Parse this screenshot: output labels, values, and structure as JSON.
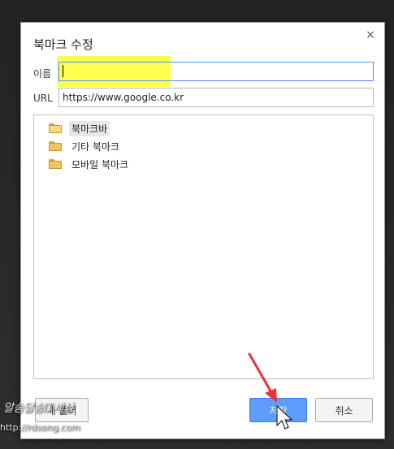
{
  "dialog": {
    "title": "북마크 수정",
    "close_glyph": "×"
  },
  "form": {
    "name_label": "이름",
    "name_value": "",
    "url_label": "URL",
    "url_value": "https://www.google.co.kr"
  },
  "tree": {
    "items": [
      {
        "label": "북마크바",
        "icon": "folder-open-icon",
        "selected": true
      },
      {
        "label": "기타 북마크",
        "icon": "folder-icon",
        "selected": false
      },
      {
        "label": "모바일 북마크",
        "icon": "folder-icon",
        "selected": false
      }
    ]
  },
  "buttons": {
    "new_folder_label": "새 폴더",
    "save_label": "저장",
    "cancel_label": "취소"
  },
  "watermark": {
    "text": "알송달송IT세상",
    "url": "http://rdsong.com"
  },
  "colors": {
    "highlight": "#fbff2e",
    "save_button": "#5f9dfb",
    "annotation_arrow": "#e8333a"
  }
}
